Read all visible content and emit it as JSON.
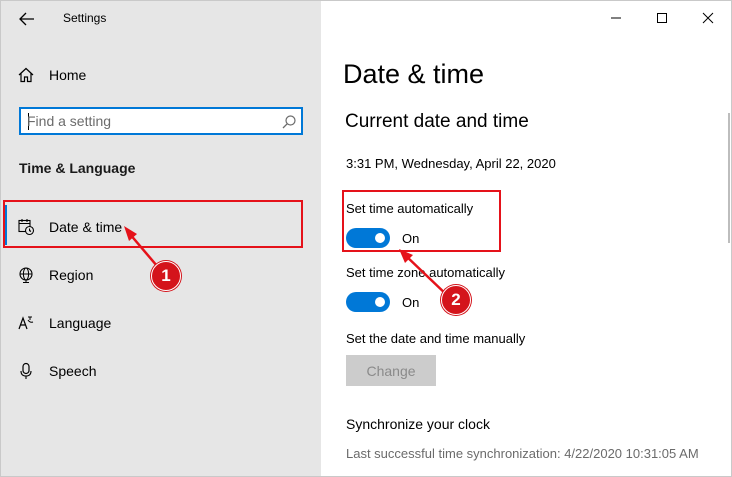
{
  "titlebar": {
    "app_title": "Settings",
    "back_icon": "arrow-left-icon",
    "minimize_icon": "minimize-icon",
    "maximize_icon": "maximize-icon",
    "close_icon": "close-icon"
  },
  "sidebar": {
    "home_label": "Home",
    "search_placeholder": "Find a setting",
    "section_title": "Time & Language",
    "items": [
      {
        "label": "Date & time",
        "icon": "calendar-clock-icon",
        "active": true
      },
      {
        "label": "Region",
        "icon": "globe-icon",
        "active": false
      },
      {
        "label": "Language",
        "icon": "language-icon",
        "active": false
      },
      {
        "label": "Speech",
        "icon": "microphone-icon",
        "active": false
      }
    ]
  },
  "main": {
    "page_title": "Date & time",
    "section_title": "Current date and time",
    "current_datetime": "3:31 PM, Wednesday, April 22, 2020",
    "set_time_auto": {
      "label": "Set time automatically",
      "state": "On"
    },
    "set_timezone_auto": {
      "label": "Set time zone automatically",
      "state": "On"
    },
    "manual": {
      "label": "Set the date and time manually",
      "button": "Change"
    },
    "sync": {
      "title": "Synchronize your clock",
      "text": "Last successful time synchronization: 4/22/2020 10:31:05 AM"
    }
  },
  "annotations": {
    "badge_1": "1",
    "badge_2": "2"
  },
  "colors": {
    "accent": "#0078d7",
    "annotation_red": "#e5121a",
    "sidebar_bg": "#e6e6e6"
  }
}
